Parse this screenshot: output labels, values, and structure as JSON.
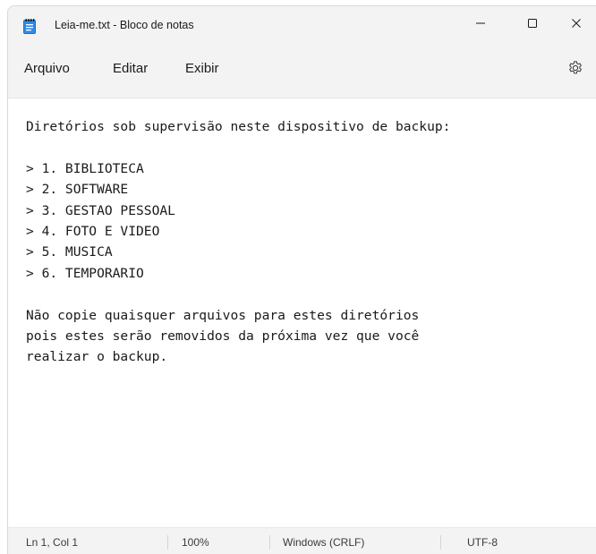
{
  "window": {
    "title": "Leia-me.txt - Bloco de notas",
    "app_icon": "notepad-icon",
    "controls": {
      "minimize_icon": "minimize-icon",
      "maximize_icon": "maximize-icon",
      "close_icon": "close-icon"
    }
  },
  "menu": {
    "items": [
      "Arquivo",
      "Editar",
      "Exibir"
    ],
    "settings_icon": "gear-icon"
  },
  "editor": {
    "content": "Diretórios sob supervisão neste dispositivo de backup:\n\n> 1. BIBLIOTECA\n> 2. SOFTWARE\n> 3. GESTAO PESSOAL\n> 4. FOTO E VIDEO\n> 5. MUSICA\n> 6. TEMPORARIO\n\nNão copie quaisquer arquivos para estes diretórios\npois estes serão removidos da próxima vez que você\nrealizar o backup."
  },
  "status": {
    "position": "Ln 1, Col 1",
    "zoom": "100%",
    "line_ending": "Windows (CRLF)",
    "encoding": "UTF-8"
  },
  "colors": {
    "chrome_background": "#f3f3f3",
    "editor_background": "#ffffff",
    "text": "#1a1a1a",
    "icon_accent": "#1e88e5"
  }
}
